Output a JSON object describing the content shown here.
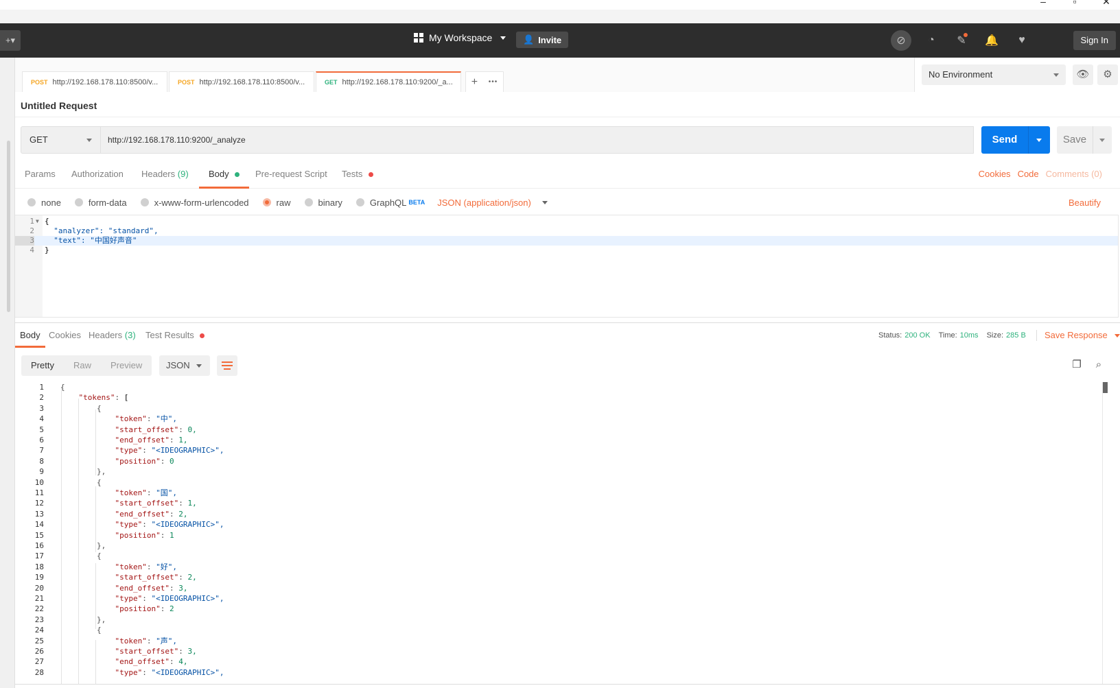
{
  "window": {
    "minimize": "–",
    "restore": "▫",
    "close": "✕"
  },
  "header": {
    "workspace_label": "My Workspace",
    "invite_label": "Invite",
    "signin_label": "Sign In"
  },
  "tabs": [
    {
      "method": "POST",
      "url": "http://192.168.178.110:8500/v..."
    },
    {
      "method": "POST",
      "url": "http://192.168.178.110:8500/v..."
    },
    {
      "method": "GET",
      "url": "http://192.168.178.110:9200/_a..."
    }
  ],
  "tab_add": "+",
  "tab_more": "•••",
  "environment": {
    "selected": "No Environment"
  },
  "request": {
    "title": "Untitled Request",
    "method": "GET",
    "url": "http://192.168.178.110:9200/_analyze",
    "send_label": "Send",
    "save_label": "Save"
  },
  "request_tabs": {
    "params": "Params",
    "authorization": "Authorization",
    "headers": "Headers",
    "headers_count": "(9)",
    "body": "Body",
    "prerequest": "Pre-request Script",
    "tests": "Tests",
    "cookies": "Cookies",
    "code": "Code",
    "comments": "Comments (0)"
  },
  "body_types": {
    "none": "none",
    "form_data": "form-data",
    "urlencoded": "x-www-form-urlencoded",
    "raw": "raw",
    "binary": "binary",
    "graphql": "GraphQL",
    "beta": "BETA",
    "content_type": "JSON (application/json)",
    "beautify": "Beautify"
  },
  "request_body_lines": [
    {
      "n": "1",
      "text": "{"
    },
    {
      "n": "2",
      "text": "  \"analyzer\": \"standard\","
    },
    {
      "n": "3",
      "text": "  \"text\": \"中国好声音\""
    },
    {
      "n": "4",
      "text": "}"
    }
  ],
  "response_tabs": {
    "body": "Body",
    "cookies": "Cookies",
    "headers": "Headers",
    "headers_count": "(3)",
    "test_results": "Test Results"
  },
  "response_status": {
    "status_label": "Status:",
    "status_value": "200 OK",
    "time_label": "Time:",
    "time_value": "10ms",
    "size_label": "Size:",
    "size_value": "285 B",
    "save_response": "Save Response"
  },
  "response_toolbar": {
    "pretty": "Pretty",
    "raw": "Raw",
    "preview": "Preview",
    "language": "JSON"
  },
  "response_lines": [
    "{",
    "    \"tokens\": [",
    "        {",
    "            \"token\": \"中\",",
    "            \"start_offset\": 0,",
    "            \"end_offset\": 1,",
    "            \"type\": \"<IDEOGRAPHIC>\",",
    "            \"position\": 0",
    "        },",
    "        {",
    "            \"token\": \"国\",",
    "            \"start_offset\": 1,",
    "            \"end_offset\": 2,",
    "            \"type\": \"<IDEOGRAPHIC>\",",
    "            \"position\": 1",
    "        },",
    "        {",
    "            \"token\": \"好\",",
    "            \"start_offset\": 2,",
    "            \"end_offset\": 3,",
    "            \"type\": \"<IDEOGRAPHIC>\",",
    "            \"position\": 2",
    "        },",
    "        {",
    "            \"token\": \"声\",",
    "            \"start_offset\": 3,",
    "            \"end_offset\": 4,",
    "            \"type\": \"<IDEOGRAPHIC>\","
  ],
  "colors": {
    "accent": "#f26b3a",
    "send": "#097bed",
    "success": "#2eb27d",
    "header_bg": "#2d2d2d"
  }
}
